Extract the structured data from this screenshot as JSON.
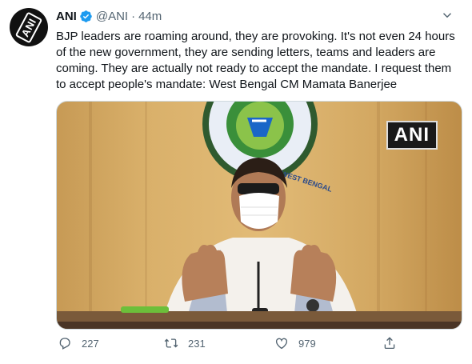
{
  "tweet": {
    "author_name": "ANI",
    "handle": "@ANI",
    "separator": "·",
    "time": "44m",
    "avatar_text": "ANI",
    "text": "BJP leaders are roaming around, they are provoking. It's not even 24 hours of the new government, they are sending letters, teams and leaders are coming. They are actually not ready to accept the mandate. I request them to accept people's mandate: West Bengal CM Mamata Banerjee",
    "media": {
      "watermark": "ANI",
      "emblem_text": "GOVT OF WEST BENGAL"
    },
    "actions": {
      "replies": "227",
      "retweets": "231",
      "likes": "979"
    }
  },
  "colors": {
    "accent": "#1d9bf0",
    "muted": "#536471",
    "text": "#0f1419"
  }
}
